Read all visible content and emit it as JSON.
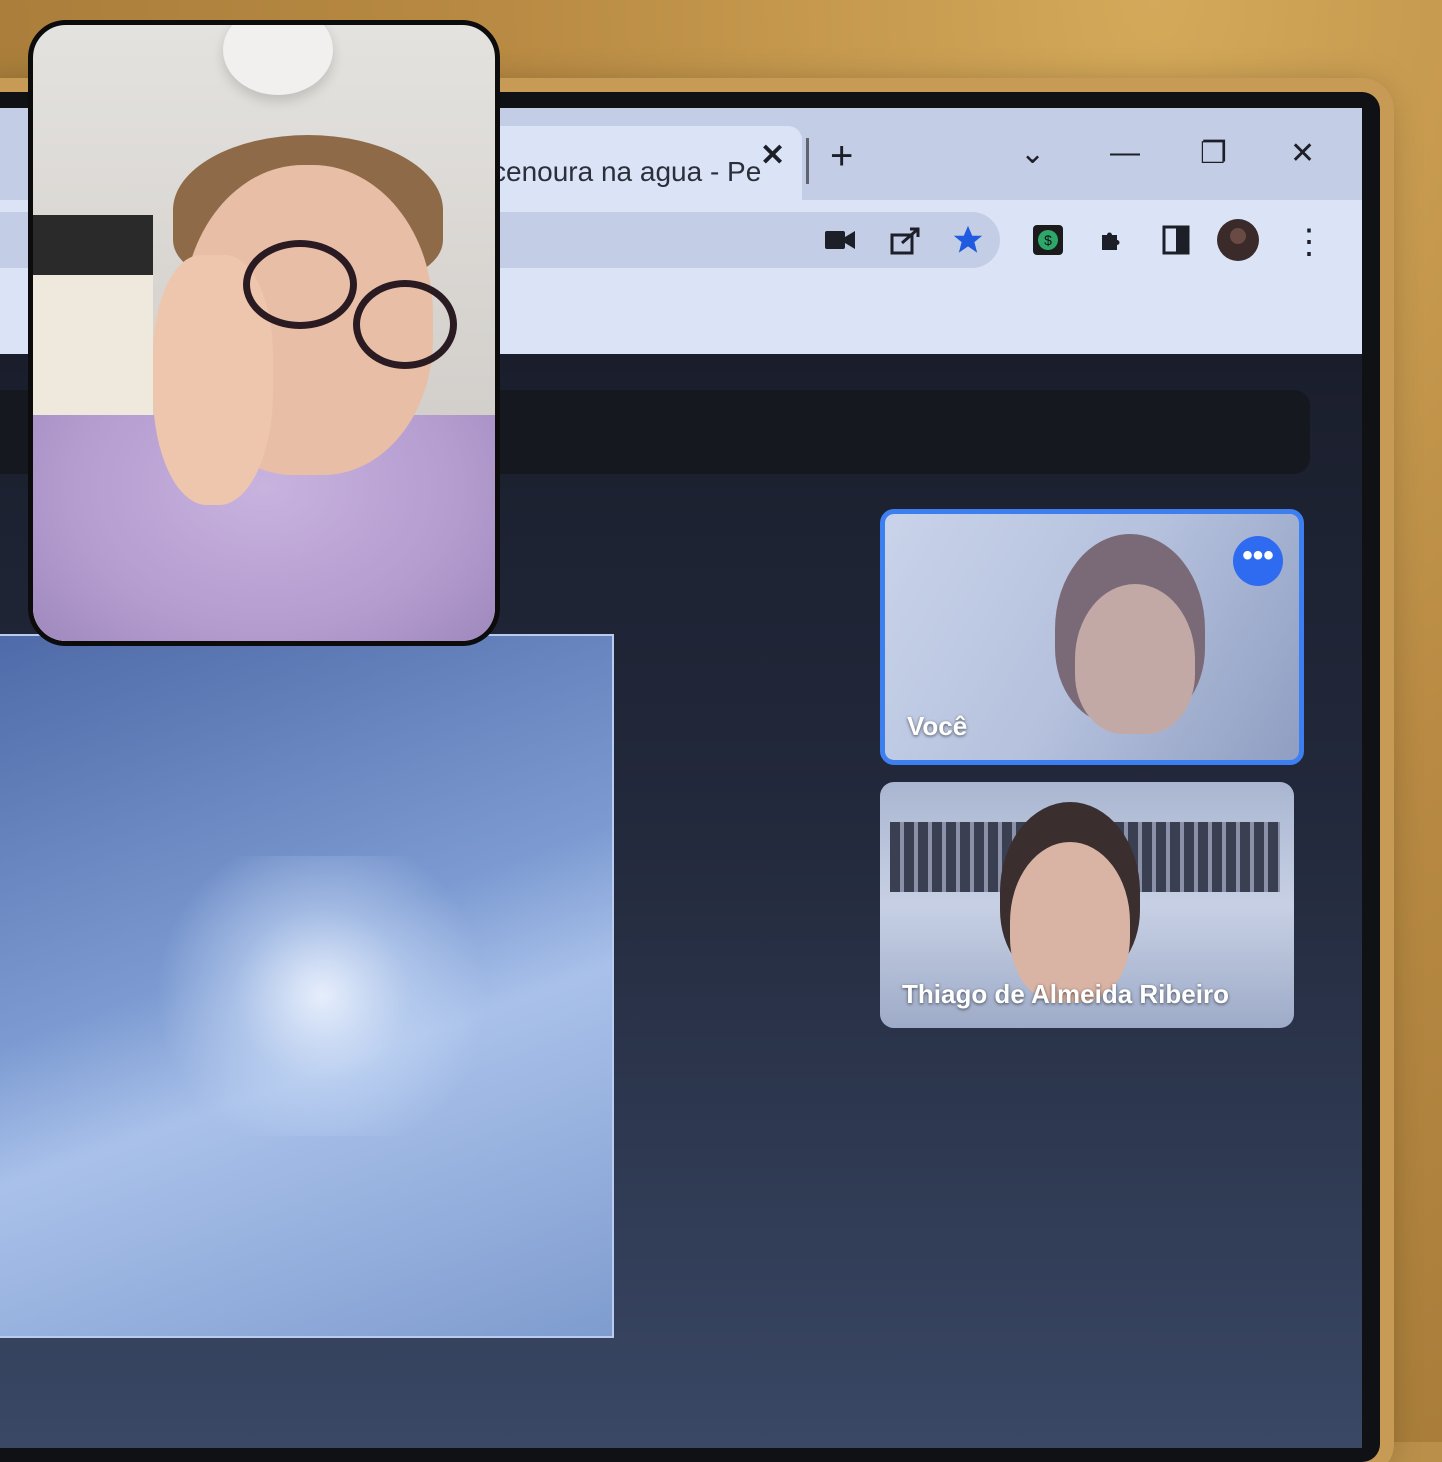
{
  "browser": {
    "tab_title": "cenoura na agua - Pes",
    "tab_close": "✕",
    "new_tab": "+",
    "win_dropdown": "⌄",
    "win_minimize": "—",
    "win_restore": "❐",
    "win_close": "✕",
    "menu_icon": "⋮"
  },
  "meet": {
    "participants": [
      {
        "name": "Você",
        "self": true
      },
      {
        "name": "Thiago de Almeida Ribeiro",
        "self": false
      }
    ],
    "more_options_label": "•••"
  },
  "colors": {
    "accent": "#3d7ff0",
    "meet_bg": "#1e2433",
    "chrome_bg": "#dbe3f6"
  }
}
